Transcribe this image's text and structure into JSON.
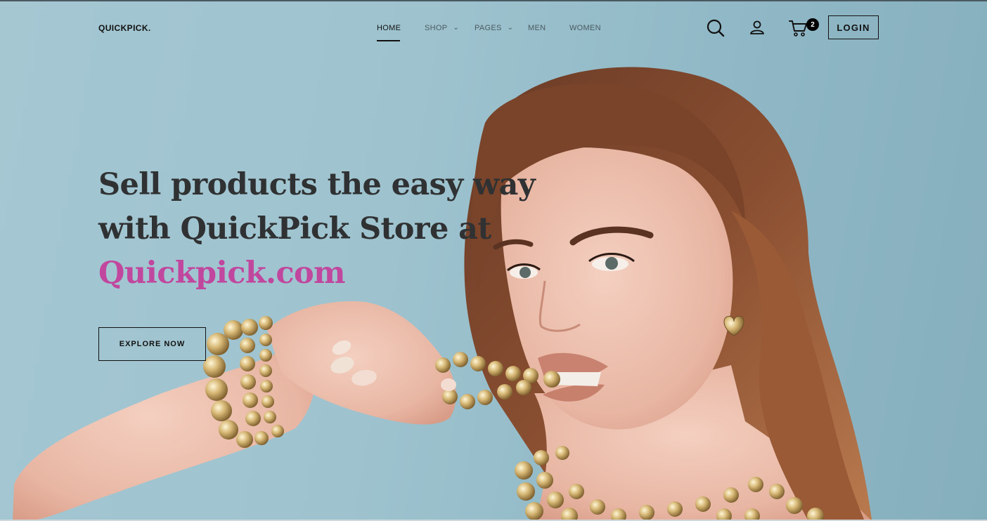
{
  "header": {
    "logo": "QUICKPICK.",
    "nav": [
      {
        "label": "HOME",
        "active": true,
        "dropdown": false
      },
      {
        "label": "SHOP",
        "active": false,
        "dropdown": true
      },
      {
        "label": "PAGES",
        "active": false,
        "dropdown": true
      },
      {
        "label": "MEN",
        "active": false,
        "dropdown": false
      },
      {
        "label": "WOMEN",
        "active": false,
        "dropdown": false
      }
    ],
    "icons": [
      "search-icon",
      "user-icon",
      "cart-icon"
    ],
    "cart_count": "2",
    "login_label": "LOGIN"
  },
  "hero": {
    "line1": "Sell products the easy way",
    "line2": "with QuickPick Store at",
    "line3": "Quickpick.com",
    "cta_label": "EXPLORE NOW",
    "image": "woman-with-gold-pearl-jewelry"
  },
  "colors": {
    "background": "#9ec3cf",
    "accent": "#c0479d",
    "text": "#2f3132"
  }
}
